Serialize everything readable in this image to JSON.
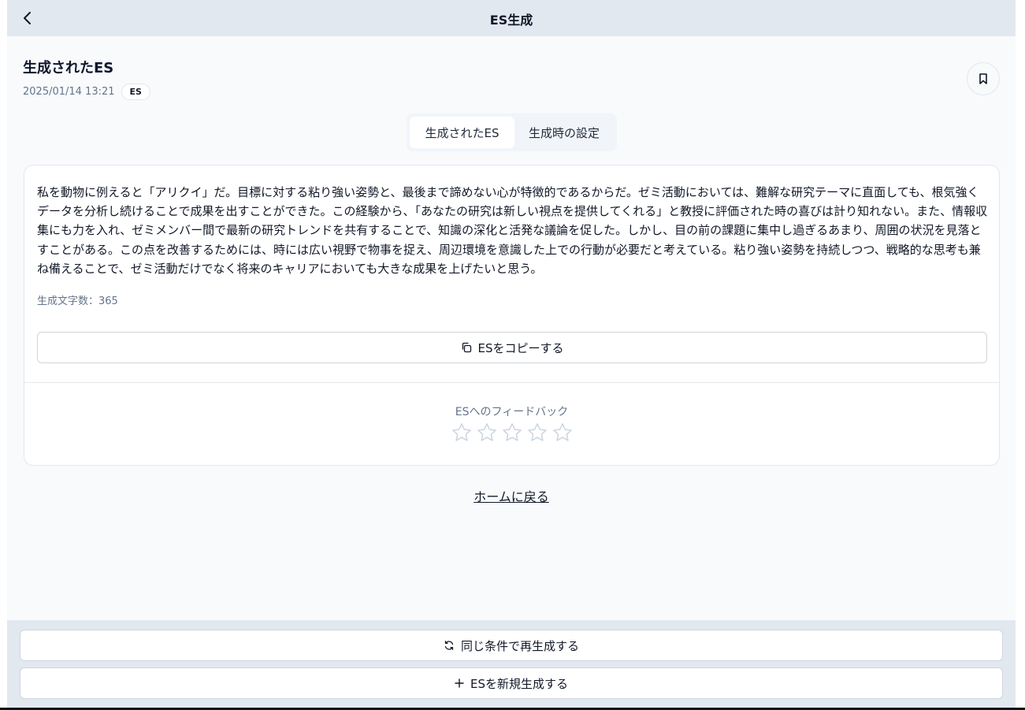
{
  "header": {
    "title": "ES生成",
    "back_icon": "chevron-left-icon"
  },
  "doc": {
    "title": "生成されたES",
    "timestamp": "2025/01/14 13:21",
    "badge": "ES",
    "bookmark_icon": "bookmark-icon"
  },
  "tabs": [
    {
      "label": "生成されたES",
      "active": true
    },
    {
      "label": "生成時の設定",
      "active": false
    }
  ],
  "es": {
    "text": "私を動物に例えると「アリクイ」だ。目標に対する粘り強い姿勢と、最後まで諦めない心が特徴的であるからだ。ゼミ活動においては、難解な研究テーマに直面しても、根気強くデータを分析し続けることで成果を出すことができた。この経験から、「あなたの研究は新しい視点を提供してくれる」と教授に評価された時の喜びは計り知れない。また、情報収集にも力を入れ、ゼミメンバー間で最新の研究トレンドを共有することで、知識の深化と活発な議論を促した。しかし、目の前の課題に集中し過ぎるあまり、周囲の状況を見落とすことがある。この点を改善するためには、時には広い視野で物事を捉え、周辺環境を意識した上での行動が必要だと考えている。粘り強い姿勢を持続しつつ、戦略的な思考も兼ね備えることで、ゼミ活動だけでなく将来のキャリアにおいても大きな成果を上げたいと思う。",
    "char_count_label": "生成文字数：",
    "char_count": "365",
    "copy_label": "ESをコピーする",
    "copy_icon": "copy-icon"
  },
  "feedback": {
    "label": "ESへのフィードバック",
    "rating": 0,
    "max_rating": 5,
    "star_icon": "star-outline-icon"
  },
  "home_link": "ホームに戻る",
  "actions": {
    "regenerate_label": "同じ条件で再生成する",
    "regenerate_icon": "refresh-icon",
    "new_label": "ESを新規生成する",
    "new_icon": "plus-icon"
  }
}
